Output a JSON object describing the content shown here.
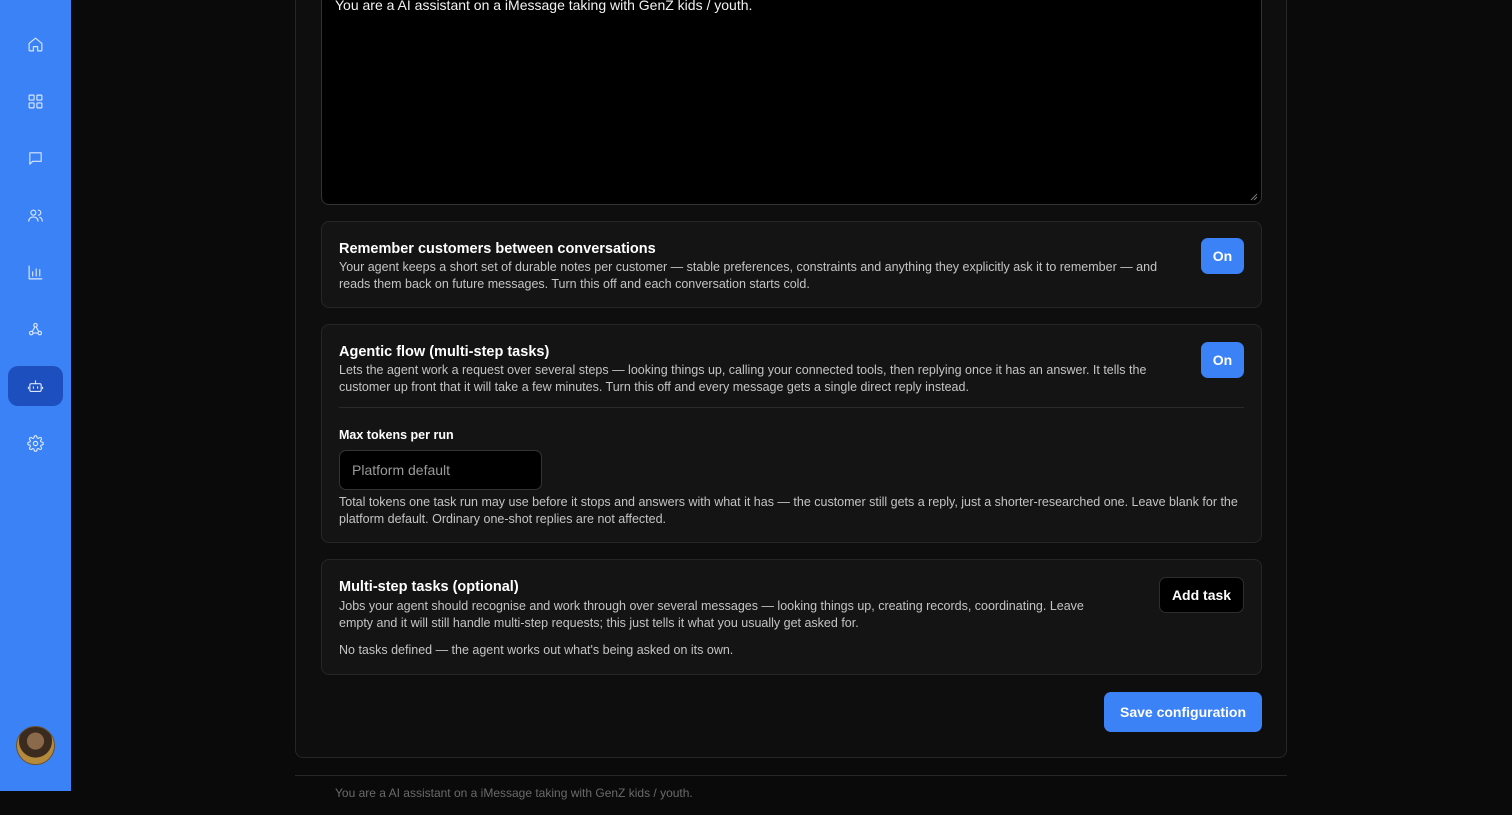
{
  "sidebar": {
    "items": [
      {
        "icon": "home-icon",
        "name": "nav-home"
      },
      {
        "icon": "dashboard-icon",
        "name": "nav-dashboard"
      },
      {
        "icon": "message-icon",
        "name": "nav-conversations"
      },
      {
        "icon": "users-icon",
        "name": "nav-customers"
      },
      {
        "icon": "bar-chart-icon",
        "name": "nav-analytics"
      },
      {
        "icon": "webhook-icon",
        "name": "nav-integrations"
      },
      {
        "icon": "bot-icon",
        "name": "nav-agent"
      },
      {
        "icon": "gear-icon",
        "name": "nav-settings"
      }
    ],
    "active": "nav-agent",
    "accent": "#3b82f6"
  },
  "prompt": {
    "value": "You are a AI assistant on a iMessage taking with GenZ kids / youth."
  },
  "memory": {
    "title": "Remember customers between conversations",
    "description": "Your agent keeps a short set of durable notes per customer — stable preferences, constraints and anything they explicitly ask it to remember — and reads them back on future messages. Turn this off and each conversation starts cold.",
    "toggle_label": "On"
  },
  "agentic": {
    "title": "Agentic flow (multi-step tasks)",
    "description": "Lets the agent work a request over several steps — looking things up, calling your connected tools, then replying once it has an answer. It tells the customer up front that it will take a few minutes. Turn this off and every message gets a single direct reply instead.",
    "toggle_label": "On",
    "max_tokens": {
      "label": "Max tokens per run",
      "placeholder": "Platform default",
      "value": "",
      "help": "Total tokens one task run may use before it stops and answers with what it has — the customer still gets a reply, just a shorter-researched one. Leave blank for the platform default. Ordinary one-shot replies are not affected."
    }
  },
  "tasks": {
    "title": "Multi-step tasks (optional)",
    "description": "Jobs your agent should recognise and work through over several messages — looking things up, creating records, coordinating. Leave empty and it will still handle multi-step requests; this just tells it what you usually get asked for.",
    "add_label": "Add task",
    "empty_text": "No tasks defined — the agent works out what's being asked on its own."
  },
  "save_label": "Save configuration",
  "next_section_peek": "You are a AI assistant on a iMessage taking with GenZ kids / youth."
}
